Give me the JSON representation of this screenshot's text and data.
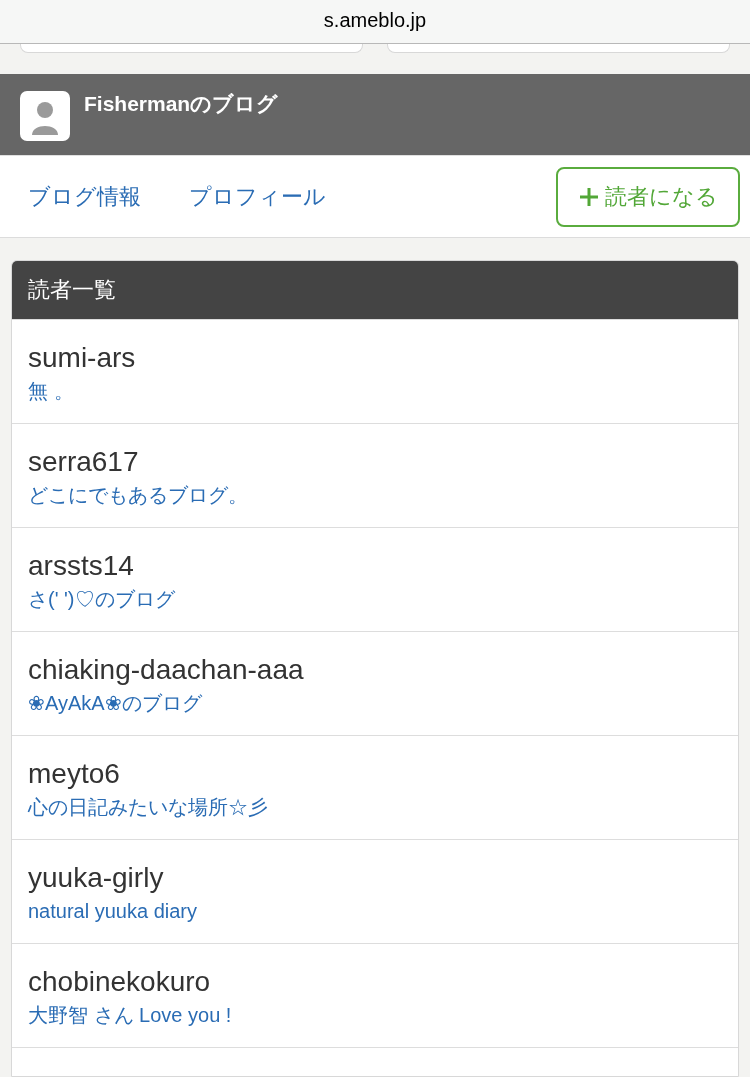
{
  "browser": {
    "address": "s.ameblo.jp"
  },
  "blog_header": {
    "title": "Fishermanのブログ"
  },
  "nav": {
    "links": [
      "ブログ情報",
      "プロフィール"
    ],
    "follow_button": {
      "label": "読者になる"
    }
  },
  "readers": {
    "title": "読者一覧",
    "items": [
      {
        "name": "sumi-ars",
        "blog": "無 。"
      },
      {
        "name": "serra617",
        "blog": "どこにでもあるブログ。"
      },
      {
        "name": "arssts14",
        "blog": "さ(' ')♡のブログ"
      },
      {
        "name": "chiaking-daachan-aaa",
        "blog": "❀AyAkA❀のブログ"
      },
      {
        "name": "meyto6",
        "blog": "心の日記みたいな場所☆彡"
      },
      {
        "name": "yuuka-girly",
        "blog": "natural yuuka diary"
      },
      {
        "name": "chobinekokuro",
        "blog": "大野智 さん Love you !"
      }
    ]
  }
}
